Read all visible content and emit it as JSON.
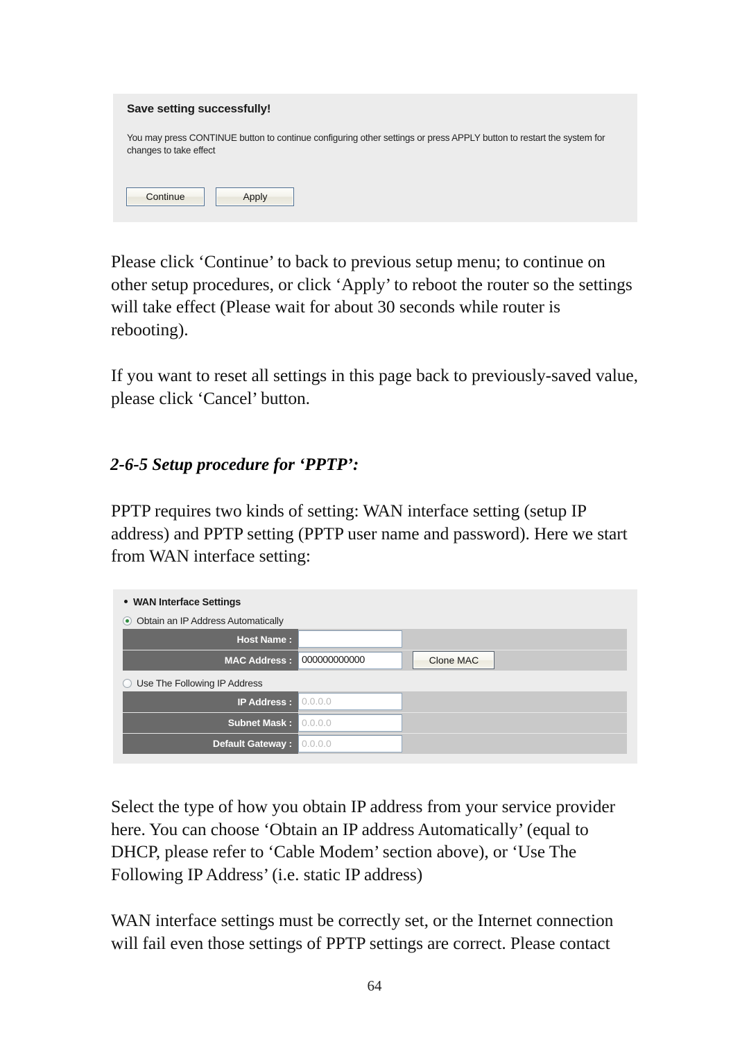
{
  "page": {
    "number": "64"
  },
  "save_screenshot": {
    "title": "Save setting successfully!",
    "body": "You may press CONTINUE button to continue configuring other settings or press APPLY button to restart the system for changes to take effect",
    "continue_label": "Continue",
    "apply_label": "Apply"
  },
  "paragraphs": {
    "p1": "Please click ‘Continue’ to back to previous setup menu; to continue on other setup procedures, or click ‘Apply’ to reboot the router so the settings will take effect (Please wait for about 30 seconds while router is rebooting).",
    "p2": "If you want to reset all settings in this page back to previously-saved value, please click ‘Cancel’ button.",
    "p3": "PPTP requires two kinds of setting: WAN interface setting (setup IP address) and PPTP setting (PPTP user name and password). Here we start from WAN interface setting:",
    "p4": "Select the type of how you obtain IP address from your service provider here. You can choose ‘Obtain an IP address Automatically’ (equal to DHCP, please refer to ‘Cable Modem’ section above), or ‘Use The Following IP Address’ (i.e. static IP address)",
    "p5": "WAN interface settings must be correctly set, or the Internet connection will fail even those settings of PPTP settings are correct. Please contact"
  },
  "section_heading": "2-6-5 Setup procedure for ‘PPTP’:",
  "wan_screenshot": {
    "section_title": "WAN Interface Settings",
    "radio_auto_label": "Obtain an IP Address Automatically",
    "radio_static_label": "Use The Following IP Address",
    "radio_auto_selected": true,
    "radio_static_selected": false,
    "auto_rows": [
      {
        "label": "Host Name :",
        "value": ""
      },
      {
        "label": "MAC Address :",
        "value": "000000000000"
      }
    ],
    "clone_mac_label": "Clone MAC",
    "static_rows": [
      {
        "label": "IP Address :",
        "value": "0.0.0.0"
      },
      {
        "label": "Subnet Mask :",
        "value": "0.0.0.0"
      },
      {
        "label": "Default Gateway :",
        "value": "0.0.0.0"
      }
    ],
    "colors": {
      "panel_bg": "#ececec",
      "label_cell_bg": "#6a6a6a",
      "field_cell_bg": "#c9c9c9",
      "radio_dot": "#2e8b3d"
    }
  }
}
